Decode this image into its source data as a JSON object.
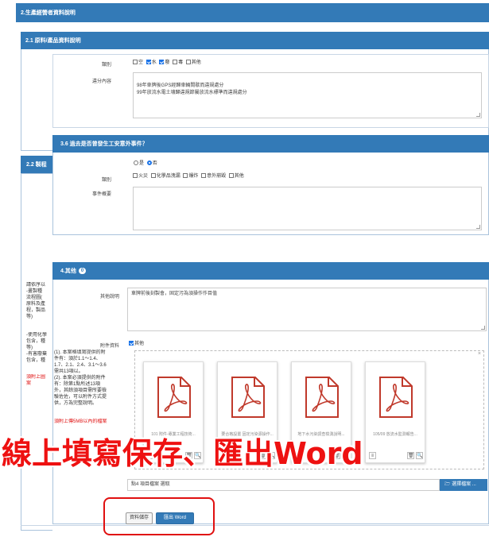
{
  "section_title": "2.生產經營者資料說明",
  "subsection_2_1": "2.1 原料/產品資料說明",
  "subsection_2_2": "2.2 製程",
  "pollution": {
    "category_label": "類別",
    "options": [
      "空",
      "水",
      "廢",
      "毒",
      "其他"
    ],
    "checked": [
      false,
      true,
      true,
      false,
      false
    ],
    "improve_label": "違分內容",
    "improve_text": "98年車牌後GPS經歸車輛間歇而違規處分\n99年放流水電土壤歸違規節屬放流水標準而違規處分"
  },
  "question_3_6": {
    "title": "3.6 過去是否曾發生工安意外事件？",
    "yes": "是",
    "no": "否",
    "selected": "no",
    "category_label": "類別",
    "options": [
      "火災",
      "化學品洩漏",
      "爆炸",
      "意外崩毀",
      "其他"
    ],
    "event_label": "事件概要"
  },
  "section_4": {
    "title": "4.其他",
    "badge": "0",
    "note_label": "其他說明",
    "note_text": "車牌前後刻製會，固定污為須操作作目值",
    "attach_label": "附件資料",
    "attach_checkbox": "其他"
  },
  "left_notes": {
    "note_a": "請依序以\n-畫製種\n流程圖(\n原料及產\n程，製品\n等)",
    "note_b": "-使用化學\n包含，種\n等)\n-有害廢棄\n包含，種",
    "note_b_red": "須附上圖\n案",
    "note_c": "(1). 本案格填寫提供的附\n件有：須於1.1～1.4、\n1.7、2.1、2.4、3.1～3.6\n需共13項以。\n(2). 本案必須提供的附件\n有：除第1點所述13項\n外，其餘須項目需所要檢\n驗佐佐，可以附件方式提\n供，方為完整說明。",
    "note_c_red": "須附上傳5MB以內的檔案"
  },
  "files": [
    {
      "name": "101 附件-專業工程技術..."
    },
    {
      "name": "要合格設置 固定污染源操作..."
    },
    {
      "name": "地下水污染調查檢測說明..."
    },
    {
      "name": "105/09 放流水監測報告..."
    }
  ],
  "file_picker": {
    "value": "點4 項目檔案 選取",
    "button": "選擇檔案 ..."
  },
  "buttons": {
    "save": "資料儲存",
    "export": "匯出 Word"
  },
  "overlay_caption": "線上填寫保存、匯出Word",
  "colors": {
    "header": "#337ab7",
    "highlight": "#e01010",
    "accent": "#1a73e8"
  }
}
